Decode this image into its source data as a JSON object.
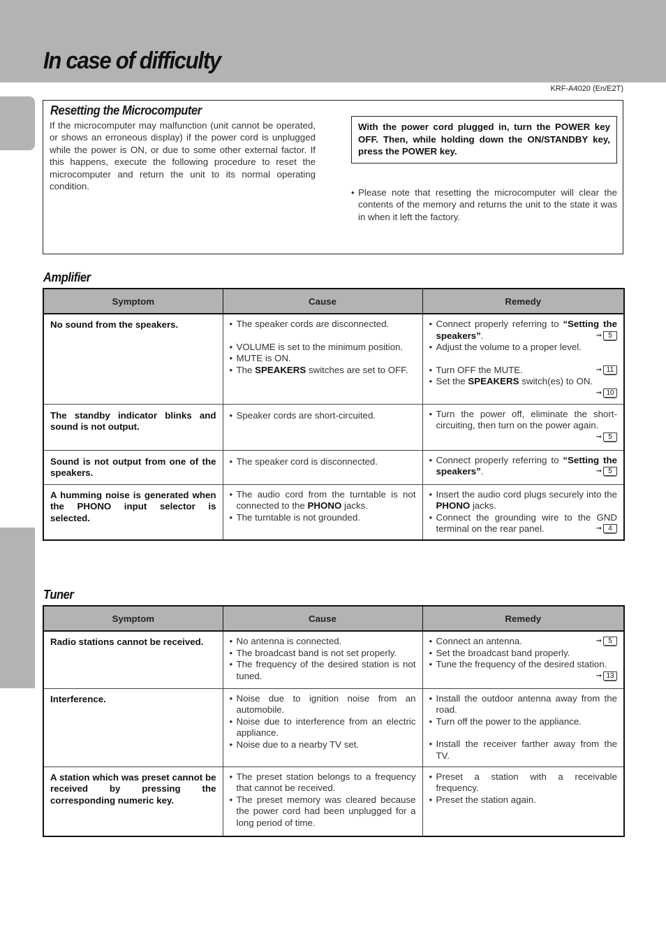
{
  "header": {
    "title": "In case of difficulty",
    "model_code": "KRF-A4020 (En/E2T)"
  },
  "reset": {
    "title": "Resetting the Microcomputer",
    "body": "If the microcomputer may malfunction (unit cannot be operated, or shows an erroneous display) if the power cord is unplugged while the power is ON, or due to some other external factor. If this happens, execute the following procedure to reset the microcomputer and return the unit to its normal operating condition.",
    "instruction": "With the power cord plugged in, turn the POWER key OFF. Then, while holding down the ON/STANDBY key, press the POWER key.",
    "note_bullet": "•",
    "note": "Please note that resetting the microcomputer will clear the contents of the memory and returns the unit to the state it was in when it left the factory."
  },
  "columns": {
    "symptom": "Symptom",
    "cause": "Cause",
    "remedy": "Remedy"
  },
  "amplifier": {
    "title": "Amplifier",
    "rows": [
      {
        "symptom": "No sound from the speakers.",
        "causes": {
          "c1": "The speaker cords are disconnected.",
          "c2": "VOLUME is set to the minimum position.",
          "c3": "MUTE is ON.",
          "c4_pre": "The ",
          "c4_bold": "SPEAKERS",
          "c4_post": " switches are set to OFF."
        },
        "remedies": {
          "r1_pre": "Connect properly referring to ",
          "r1_bold": "“Setting the speakers”",
          "r1_post": ".",
          "r1_ref": "5",
          "r2": "Adjust the volume to a proper level.",
          "r3": "Turn OFF the MUTE.",
          "r3_ref": "11",
          "r4_pre": "Set the ",
          "r4_bold": "SPEAKERS",
          "r4_post": " switch(es) to ON.",
          "r4_ref": "10"
        }
      },
      {
        "symptom": "The standby indicator blinks and sound is not output.",
        "causes": {
          "c1": "Speaker cords are short-circuited."
        },
        "remedies": {
          "r1": "Turn the power off, eliminate the short-circuiting, then turn on the power again.",
          "r1_ref": "5"
        }
      },
      {
        "symptom": "Sound is not output from one of the speakers.",
        "causes": {
          "c1": "The speaker cord is disconnected."
        },
        "remedies": {
          "r1_pre": "Connect properly referring to ",
          "r1_bold": "“Setting the speakers”",
          "r1_post": ".",
          "r1_ref": "5"
        }
      },
      {
        "symptom": "A humming noise is generated when the PHONO input selector is selected.",
        "causes": {
          "c1_pre": "The audio cord from the turntable is not connected to the ",
          "c1_bold": "PHONO",
          "c1_post": " jacks.",
          "c2": "The turntable is not grounded."
        },
        "remedies": {
          "r1_pre": "Insert the audio cord plugs securely into the ",
          "r1_bold": "PHONO",
          "r1_post": " jacks.",
          "r2": "Connect the grounding wire to the GND terminal on the rear panel.",
          "r2_ref": "4"
        }
      }
    ]
  },
  "tuner": {
    "title": "Tuner",
    "rows": [
      {
        "symptom": "Radio stations cannot be received.",
        "causes": {
          "c1": "No antenna is connected.",
          "c2": "The broadcast band is not set properly.",
          "c3": "The frequency of the desired station is not tuned."
        },
        "remedies": {
          "r1": "Connect an antenna.",
          "r1_ref": "5",
          "r2": "Set the broadcast band properly.",
          "r3": "Tune the frequency of the desired station.",
          "r3_ref": "13"
        }
      },
      {
        "symptom": "Interference.",
        "causes": {
          "c1": "Noise due to ignition noise from an automobile.",
          "c2": "Noise due to interference from an electric appliance.",
          "c3": "Noise due to a nearby TV set."
        },
        "remedies": {
          "r1": "Install the outdoor antenna away from the road.",
          "r2": "Turn off the power to the appliance.",
          "r3": "Install the receiver farther away from the TV."
        }
      },
      {
        "symptom": "A station which was preset cannot be received by pressing the corresponding numeric key.",
        "causes": {
          "c1": "The preset station belongs to a frequency that cannot be received.",
          "c2": "The preset memory was cleared because the power cord had been unplugged for a long period of time."
        },
        "remedies": {
          "r1": "Preset a station with a receivable frequency.",
          "r2": "Preset the station again."
        }
      }
    ]
  }
}
